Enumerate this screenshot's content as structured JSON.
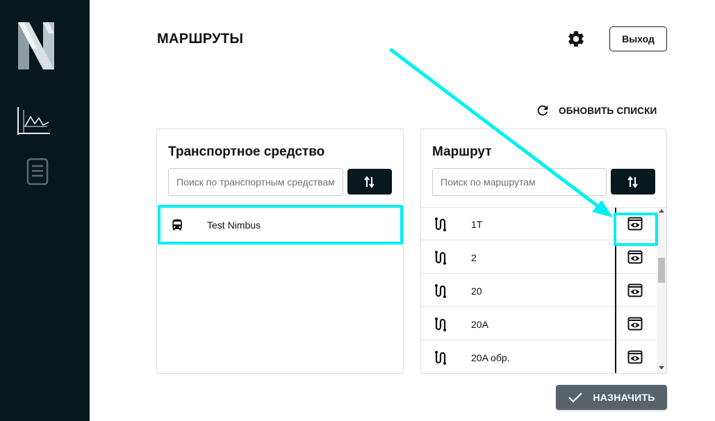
{
  "page": {
    "title": "МАРШРУТЫ"
  },
  "sidebar": {
    "logo_icon": "nimbus-n-logo",
    "items": [
      {
        "icon": "chart-icon",
        "active": true
      },
      {
        "icon": "document-icon",
        "active": false
      }
    ]
  },
  "header": {
    "settings_icon": "gear-icon",
    "exit_label": "Выход",
    "refresh_label": "ОБНОВИТЬ СПИСКИ"
  },
  "vehicles_panel": {
    "title": "Транспортное средство",
    "search_placeholder": "Поиск по транспортным средствам",
    "items": [
      {
        "name": "Test Nimbus",
        "icon": "bus-icon"
      }
    ]
  },
  "routes_panel": {
    "title": "Маршрут",
    "search_placeholder": "Поиск по маршрутам",
    "items": [
      {
        "name": "1T",
        "icon": "route-icon",
        "action_icon": "eye-icon"
      },
      {
        "name": "2",
        "icon": "route-icon",
        "action_icon": "eye-icon"
      },
      {
        "name": "20",
        "icon": "route-icon",
        "action_icon": "eye-icon"
      },
      {
        "name": "20A",
        "icon": "route-icon",
        "action_icon": "eye-icon"
      },
      {
        "name": "20A обр.",
        "icon": "route-icon",
        "action_icon": "eye-icon"
      }
    ]
  },
  "footer": {
    "assign_label": "НАЗНАЧИТЬ"
  },
  "colors": {
    "sidebar_bg": "#06171e",
    "primary_dark": "#07171e",
    "assign_button": "#57626a",
    "annotation_highlight": "#00f0f0"
  }
}
